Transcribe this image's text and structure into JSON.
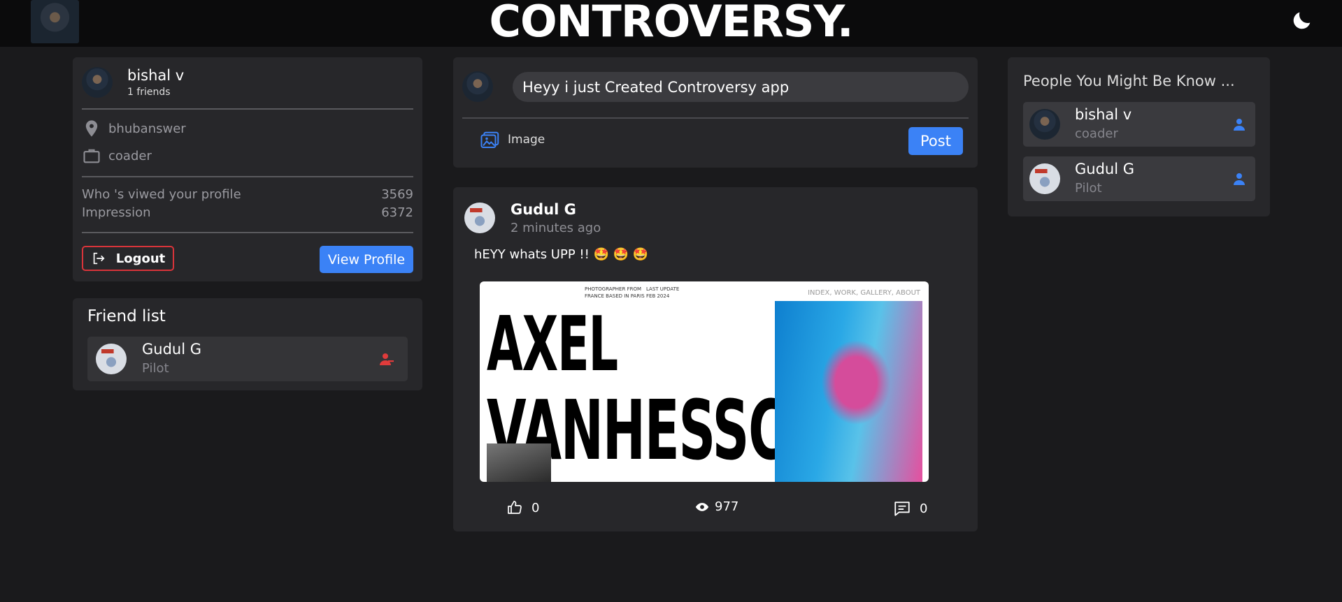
{
  "app": {
    "brand": "CONTROVERSY."
  },
  "profile": {
    "name": "bishal v",
    "friends": "1 friends",
    "location": "bhubanswer",
    "work": "coader",
    "stats": [
      {
        "label": "Who 's viwed your profile",
        "value": "3569"
      },
      {
        "label": "Impression",
        "value": "6372"
      }
    ],
    "logout_label": "Logout",
    "view_profile_label": "View Profile"
  },
  "friend_list": {
    "title": "Friend list",
    "items": [
      {
        "name": "Gudul G",
        "role": "Pilot"
      }
    ]
  },
  "composer": {
    "input_value": "Heyy i just Created Controversy app",
    "image_label": "Image",
    "post_label": "Post"
  },
  "post": {
    "author": "Gudul G",
    "time": "2 minutes ago",
    "text": "hEYY whats UPP !! 🤩 🤩 🤩",
    "image": {
      "title_line1": "AXEL",
      "title_line2": "VANHESSCHE",
      "caption1": "PHOTOGRAPHER FROM\nFRANCE BASED IN PARIS",
      "caption2": "LAST UPDATE\nFEB 2024",
      "nav": "INDEX, WORK, GALLERY, ABOUT"
    },
    "likes": "0",
    "views": "977",
    "comments": "0"
  },
  "suggestions": {
    "title": "People You Might Be Know ...",
    "items": [
      {
        "name": "bishal v",
        "role": "coader"
      },
      {
        "name": "Gudul G",
        "role": "Pilot"
      }
    ]
  },
  "colors": {
    "accent": "#3b82f6",
    "danger": "#d9343a",
    "card": "#27272a",
    "bg": "#1a1a1c"
  }
}
